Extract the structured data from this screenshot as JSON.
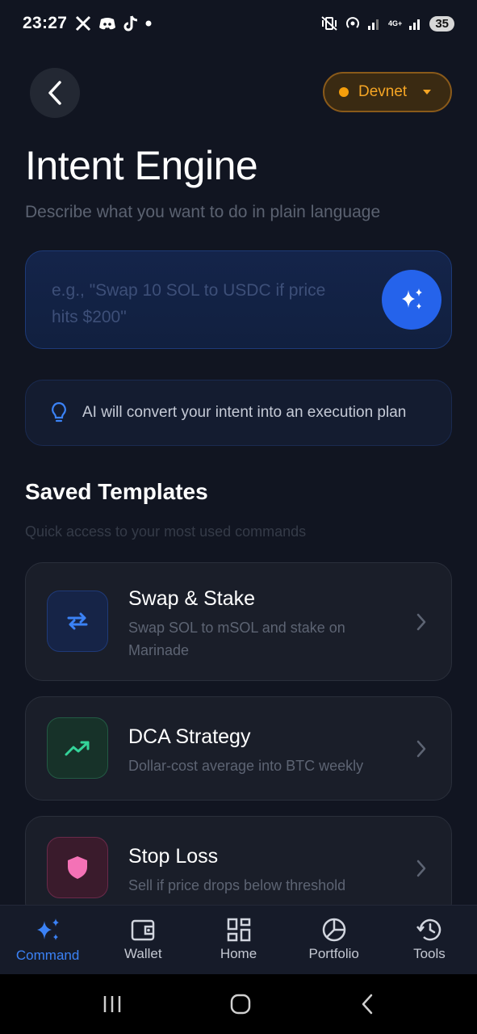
{
  "status_bar": {
    "time": "23:27",
    "battery": "35",
    "network_type": "4G+",
    "left_icons": [
      "x-icon",
      "discord-icon",
      "tiktok-icon",
      "dot-icon"
    ],
    "right_icons": [
      "mute-vibrate-icon",
      "hotspot-icon",
      "signal-icon",
      "signal-icon"
    ]
  },
  "header": {
    "back_icon": "chevron-left-icon",
    "network_selector": {
      "label": "Devnet",
      "dot_color": "#f59e0b"
    }
  },
  "page": {
    "title": "Intent Engine",
    "subtitle": "Describe what you want to do in plain language"
  },
  "intent_input": {
    "placeholder": "e.g., \"Swap 10 SOL to USDC if price hits $200\"",
    "submit_icon": "sparkles-icon"
  },
  "ai_hint": {
    "icon": "lightbulb-icon",
    "text": "AI will convert your intent into an execution plan"
  },
  "templates_section": {
    "title": "Saved Templates",
    "subtitle": "Quick access to your most used commands",
    "items": [
      {
        "title": "Swap & Stake",
        "description": "Swap SOL to mSOL and stake on Marinade",
        "icon": "swap-arrows-icon",
        "color": "#3b82f6"
      },
      {
        "title": "DCA Strategy",
        "description": "Dollar-cost average into BTC weekly",
        "icon": "trending-up-icon",
        "color": "#34d399"
      },
      {
        "title": "Stop Loss",
        "description": "Sell if price drops below threshold",
        "icon": "shield-icon",
        "color": "#f472b6"
      }
    ]
  },
  "bottom_nav": {
    "items": [
      {
        "label": "Command",
        "icon": "sparkles-icon",
        "active": true
      },
      {
        "label": "Wallet",
        "icon": "wallet-icon",
        "active": false
      },
      {
        "label": "Home",
        "icon": "grid-icon",
        "active": false
      },
      {
        "label": "Portfolio",
        "icon": "pie-chart-icon",
        "active": false
      },
      {
        "label": "Tools",
        "icon": "history-icon",
        "active": false
      }
    ]
  },
  "system_nav": [
    "recents-icon",
    "home-icon",
    "back-icon"
  ]
}
